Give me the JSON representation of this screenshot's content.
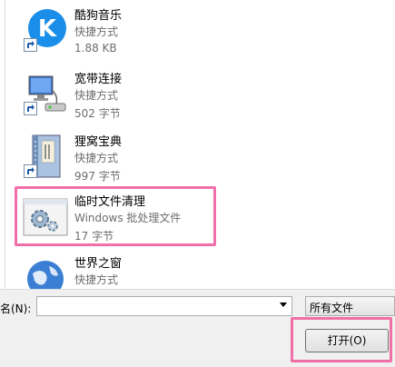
{
  "files": [
    {
      "name": "酷狗音乐",
      "type": "快捷方式",
      "size": "1.88 KB",
      "icon": "kugou-icon"
    },
    {
      "name": "宽带连接",
      "type": "快捷方式",
      "size": "502 字节",
      "icon": "network-icon"
    },
    {
      "name": "狸窝宝典",
      "type": "快捷方式",
      "size": "997 字节",
      "icon": "book-icon"
    },
    {
      "name": "临时文件清理",
      "type": "Windows 批处理文件",
      "size": "17 字节",
      "icon": "batch-file-icon"
    },
    {
      "name": "世界之窗",
      "type": "快捷方式",
      "size": "",
      "icon": "globe-icon"
    }
  ],
  "footer": {
    "filename_label": "名(N):",
    "filename_value": "",
    "filter_value": "所有文件",
    "open_label": "打开(O)"
  },
  "colors": {
    "highlight": "#f06fa8",
    "kugou_blue": "#1a8ee8"
  }
}
